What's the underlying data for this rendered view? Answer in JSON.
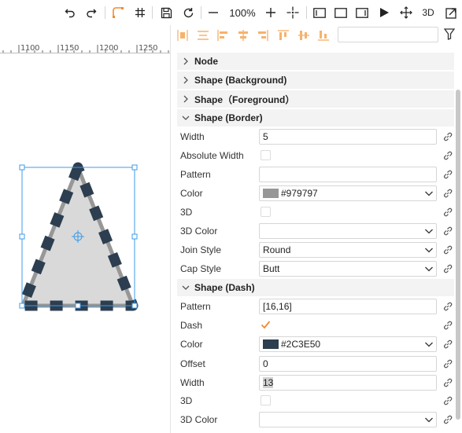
{
  "toolbar": {
    "zoom": "100%",
    "three_d": "3D"
  },
  "ruler": {
    "labels": [
      "1100",
      "1150",
      "1200",
      "1250"
    ]
  },
  "shape": {
    "fill": "#d9d9d9",
    "border_color": "#979797",
    "dash_color": "#2C3E50",
    "selection_color": "#3c9be8"
  },
  "sections": {
    "node": "Node",
    "background": "Shape (Background)",
    "foreground": "Shape（Foreground）",
    "border": "Shape (Border)",
    "dash": "Shape (Dash)"
  },
  "border": {
    "width": {
      "label": "Width",
      "value": "5"
    },
    "absolute_width": {
      "label": "Absolute Width",
      "checked": false
    },
    "pattern": {
      "label": "Pattern",
      "value": ""
    },
    "color": {
      "label": "Color",
      "value": "#979797",
      "swatch": "#979797"
    },
    "three_d": {
      "label": "3D",
      "checked": false
    },
    "three_d_color": {
      "label": "3D Color",
      "value": ""
    },
    "join_style": {
      "label": "Join Style",
      "value": "Round"
    },
    "cap_style": {
      "label": "Cap Style",
      "value": "Butt"
    }
  },
  "dash": {
    "pattern": {
      "label": "Pattern",
      "value": "[16,16]"
    },
    "dash": {
      "label": "Dash",
      "checked": true
    },
    "color": {
      "label": "Color",
      "value": "#2C3E50",
      "swatch": "#2C3E50"
    },
    "offset": {
      "label": "Offset",
      "value": "0"
    },
    "width": {
      "label": "Width",
      "value": "13"
    },
    "three_d": {
      "label": "3D",
      "checked": false
    },
    "three_d_color": {
      "label": "3D Color",
      "value": ""
    }
  },
  "accent_color": "#f08c2e"
}
